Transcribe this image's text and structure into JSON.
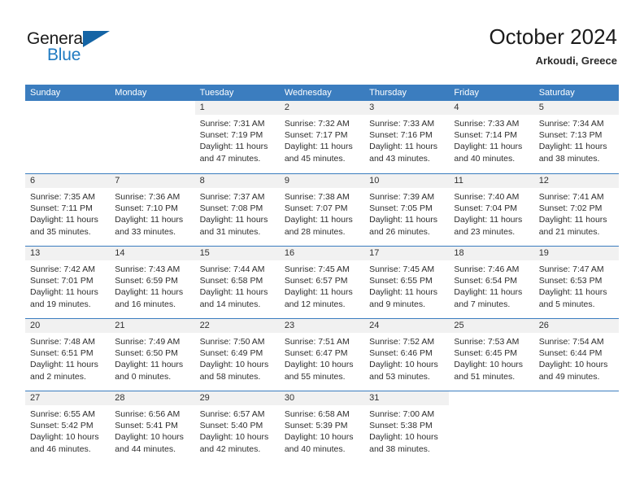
{
  "brand": {
    "name_part1": "General",
    "name_part2": "Blue",
    "triangle_icon": "triangle-icon",
    "accent_color": "#1f7ac1",
    "triangle_color": "#1464a5"
  },
  "header": {
    "title": "October 2024",
    "subtitle": "Arkoudi, Greece"
  },
  "calendar": {
    "header_color": "#3b7dbf",
    "daynum_background": "#f1f1f1",
    "weekdays": [
      "Sunday",
      "Monday",
      "Tuesday",
      "Wednesday",
      "Thursday",
      "Friday",
      "Saturday"
    ],
    "weeks": [
      [
        {
          "day": "",
          "sunrise": "",
          "sunset": "",
          "daylight1": "",
          "daylight2": "",
          "blank": true
        },
        {
          "day": "",
          "sunrise": "",
          "sunset": "",
          "daylight1": "",
          "daylight2": "",
          "blank": true
        },
        {
          "day": "1",
          "sunrise": "Sunrise: 7:31 AM",
          "sunset": "Sunset: 7:19 PM",
          "daylight1": "Daylight: 11 hours",
          "daylight2": "and 47 minutes."
        },
        {
          "day": "2",
          "sunrise": "Sunrise: 7:32 AM",
          "sunset": "Sunset: 7:17 PM",
          "daylight1": "Daylight: 11 hours",
          "daylight2": "and 45 minutes."
        },
        {
          "day": "3",
          "sunrise": "Sunrise: 7:33 AM",
          "sunset": "Sunset: 7:16 PM",
          "daylight1": "Daylight: 11 hours",
          "daylight2": "and 43 minutes."
        },
        {
          "day": "4",
          "sunrise": "Sunrise: 7:33 AM",
          "sunset": "Sunset: 7:14 PM",
          "daylight1": "Daylight: 11 hours",
          "daylight2": "and 40 minutes."
        },
        {
          "day": "5",
          "sunrise": "Sunrise: 7:34 AM",
          "sunset": "Sunset: 7:13 PM",
          "daylight1": "Daylight: 11 hours",
          "daylight2": "and 38 minutes."
        }
      ],
      [
        {
          "day": "6",
          "sunrise": "Sunrise: 7:35 AM",
          "sunset": "Sunset: 7:11 PM",
          "daylight1": "Daylight: 11 hours",
          "daylight2": "and 35 minutes."
        },
        {
          "day": "7",
          "sunrise": "Sunrise: 7:36 AM",
          "sunset": "Sunset: 7:10 PM",
          "daylight1": "Daylight: 11 hours",
          "daylight2": "and 33 minutes."
        },
        {
          "day": "8",
          "sunrise": "Sunrise: 7:37 AM",
          "sunset": "Sunset: 7:08 PM",
          "daylight1": "Daylight: 11 hours",
          "daylight2": "and 31 minutes."
        },
        {
          "day": "9",
          "sunrise": "Sunrise: 7:38 AM",
          "sunset": "Sunset: 7:07 PM",
          "daylight1": "Daylight: 11 hours",
          "daylight2": "and 28 minutes."
        },
        {
          "day": "10",
          "sunrise": "Sunrise: 7:39 AM",
          "sunset": "Sunset: 7:05 PM",
          "daylight1": "Daylight: 11 hours",
          "daylight2": "and 26 minutes."
        },
        {
          "day": "11",
          "sunrise": "Sunrise: 7:40 AM",
          "sunset": "Sunset: 7:04 PM",
          "daylight1": "Daylight: 11 hours",
          "daylight2": "and 23 minutes."
        },
        {
          "day": "12",
          "sunrise": "Sunrise: 7:41 AM",
          "sunset": "Sunset: 7:02 PM",
          "daylight1": "Daylight: 11 hours",
          "daylight2": "and 21 minutes."
        }
      ],
      [
        {
          "day": "13",
          "sunrise": "Sunrise: 7:42 AM",
          "sunset": "Sunset: 7:01 PM",
          "daylight1": "Daylight: 11 hours",
          "daylight2": "and 19 minutes."
        },
        {
          "day": "14",
          "sunrise": "Sunrise: 7:43 AM",
          "sunset": "Sunset: 6:59 PM",
          "daylight1": "Daylight: 11 hours",
          "daylight2": "and 16 minutes."
        },
        {
          "day": "15",
          "sunrise": "Sunrise: 7:44 AM",
          "sunset": "Sunset: 6:58 PM",
          "daylight1": "Daylight: 11 hours",
          "daylight2": "and 14 minutes."
        },
        {
          "day": "16",
          "sunrise": "Sunrise: 7:45 AM",
          "sunset": "Sunset: 6:57 PM",
          "daylight1": "Daylight: 11 hours",
          "daylight2": "and 12 minutes."
        },
        {
          "day": "17",
          "sunrise": "Sunrise: 7:45 AM",
          "sunset": "Sunset: 6:55 PM",
          "daylight1": "Daylight: 11 hours",
          "daylight2": "and 9 minutes."
        },
        {
          "day": "18",
          "sunrise": "Sunrise: 7:46 AM",
          "sunset": "Sunset: 6:54 PM",
          "daylight1": "Daylight: 11 hours",
          "daylight2": "and 7 minutes."
        },
        {
          "day": "19",
          "sunrise": "Sunrise: 7:47 AM",
          "sunset": "Sunset: 6:53 PM",
          "daylight1": "Daylight: 11 hours",
          "daylight2": "and 5 minutes."
        }
      ],
      [
        {
          "day": "20",
          "sunrise": "Sunrise: 7:48 AM",
          "sunset": "Sunset: 6:51 PM",
          "daylight1": "Daylight: 11 hours",
          "daylight2": "and 2 minutes."
        },
        {
          "day": "21",
          "sunrise": "Sunrise: 7:49 AM",
          "sunset": "Sunset: 6:50 PM",
          "daylight1": "Daylight: 11 hours",
          "daylight2": "and 0 minutes."
        },
        {
          "day": "22",
          "sunrise": "Sunrise: 7:50 AM",
          "sunset": "Sunset: 6:49 PM",
          "daylight1": "Daylight: 10 hours",
          "daylight2": "and 58 minutes."
        },
        {
          "day": "23",
          "sunrise": "Sunrise: 7:51 AM",
          "sunset": "Sunset: 6:47 PM",
          "daylight1": "Daylight: 10 hours",
          "daylight2": "and 55 minutes."
        },
        {
          "day": "24",
          "sunrise": "Sunrise: 7:52 AM",
          "sunset": "Sunset: 6:46 PM",
          "daylight1": "Daylight: 10 hours",
          "daylight2": "and 53 minutes."
        },
        {
          "day": "25",
          "sunrise": "Sunrise: 7:53 AM",
          "sunset": "Sunset: 6:45 PM",
          "daylight1": "Daylight: 10 hours",
          "daylight2": "and 51 minutes."
        },
        {
          "day": "26",
          "sunrise": "Sunrise: 7:54 AM",
          "sunset": "Sunset: 6:44 PM",
          "daylight1": "Daylight: 10 hours",
          "daylight2": "and 49 minutes."
        }
      ],
      [
        {
          "day": "27",
          "sunrise": "Sunrise: 6:55 AM",
          "sunset": "Sunset: 5:42 PM",
          "daylight1": "Daylight: 10 hours",
          "daylight2": "and 46 minutes."
        },
        {
          "day": "28",
          "sunrise": "Sunrise: 6:56 AM",
          "sunset": "Sunset: 5:41 PM",
          "daylight1": "Daylight: 10 hours",
          "daylight2": "and 44 minutes."
        },
        {
          "day": "29",
          "sunrise": "Sunrise: 6:57 AM",
          "sunset": "Sunset: 5:40 PM",
          "daylight1": "Daylight: 10 hours",
          "daylight2": "and 42 minutes."
        },
        {
          "day": "30",
          "sunrise": "Sunrise: 6:58 AM",
          "sunset": "Sunset: 5:39 PM",
          "daylight1": "Daylight: 10 hours",
          "daylight2": "and 40 minutes."
        },
        {
          "day": "31",
          "sunrise": "Sunrise: 7:00 AM",
          "sunset": "Sunset: 5:38 PM",
          "daylight1": "Daylight: 10 hours",
          "daylight2": "and 38 minutes."
        },
        {
          "day": "",
          "sunrise": "",
          "sunset": "",
          "daylight1": "",
          "daylight2": "",
          "blank": true
        },
        {
          "day": "",
          "sunrise": "",
          "sunset": "",
          "daylight1": "",
          "daylight2": "",
          "blank": true
        }
      ]
    ]
  }
}
